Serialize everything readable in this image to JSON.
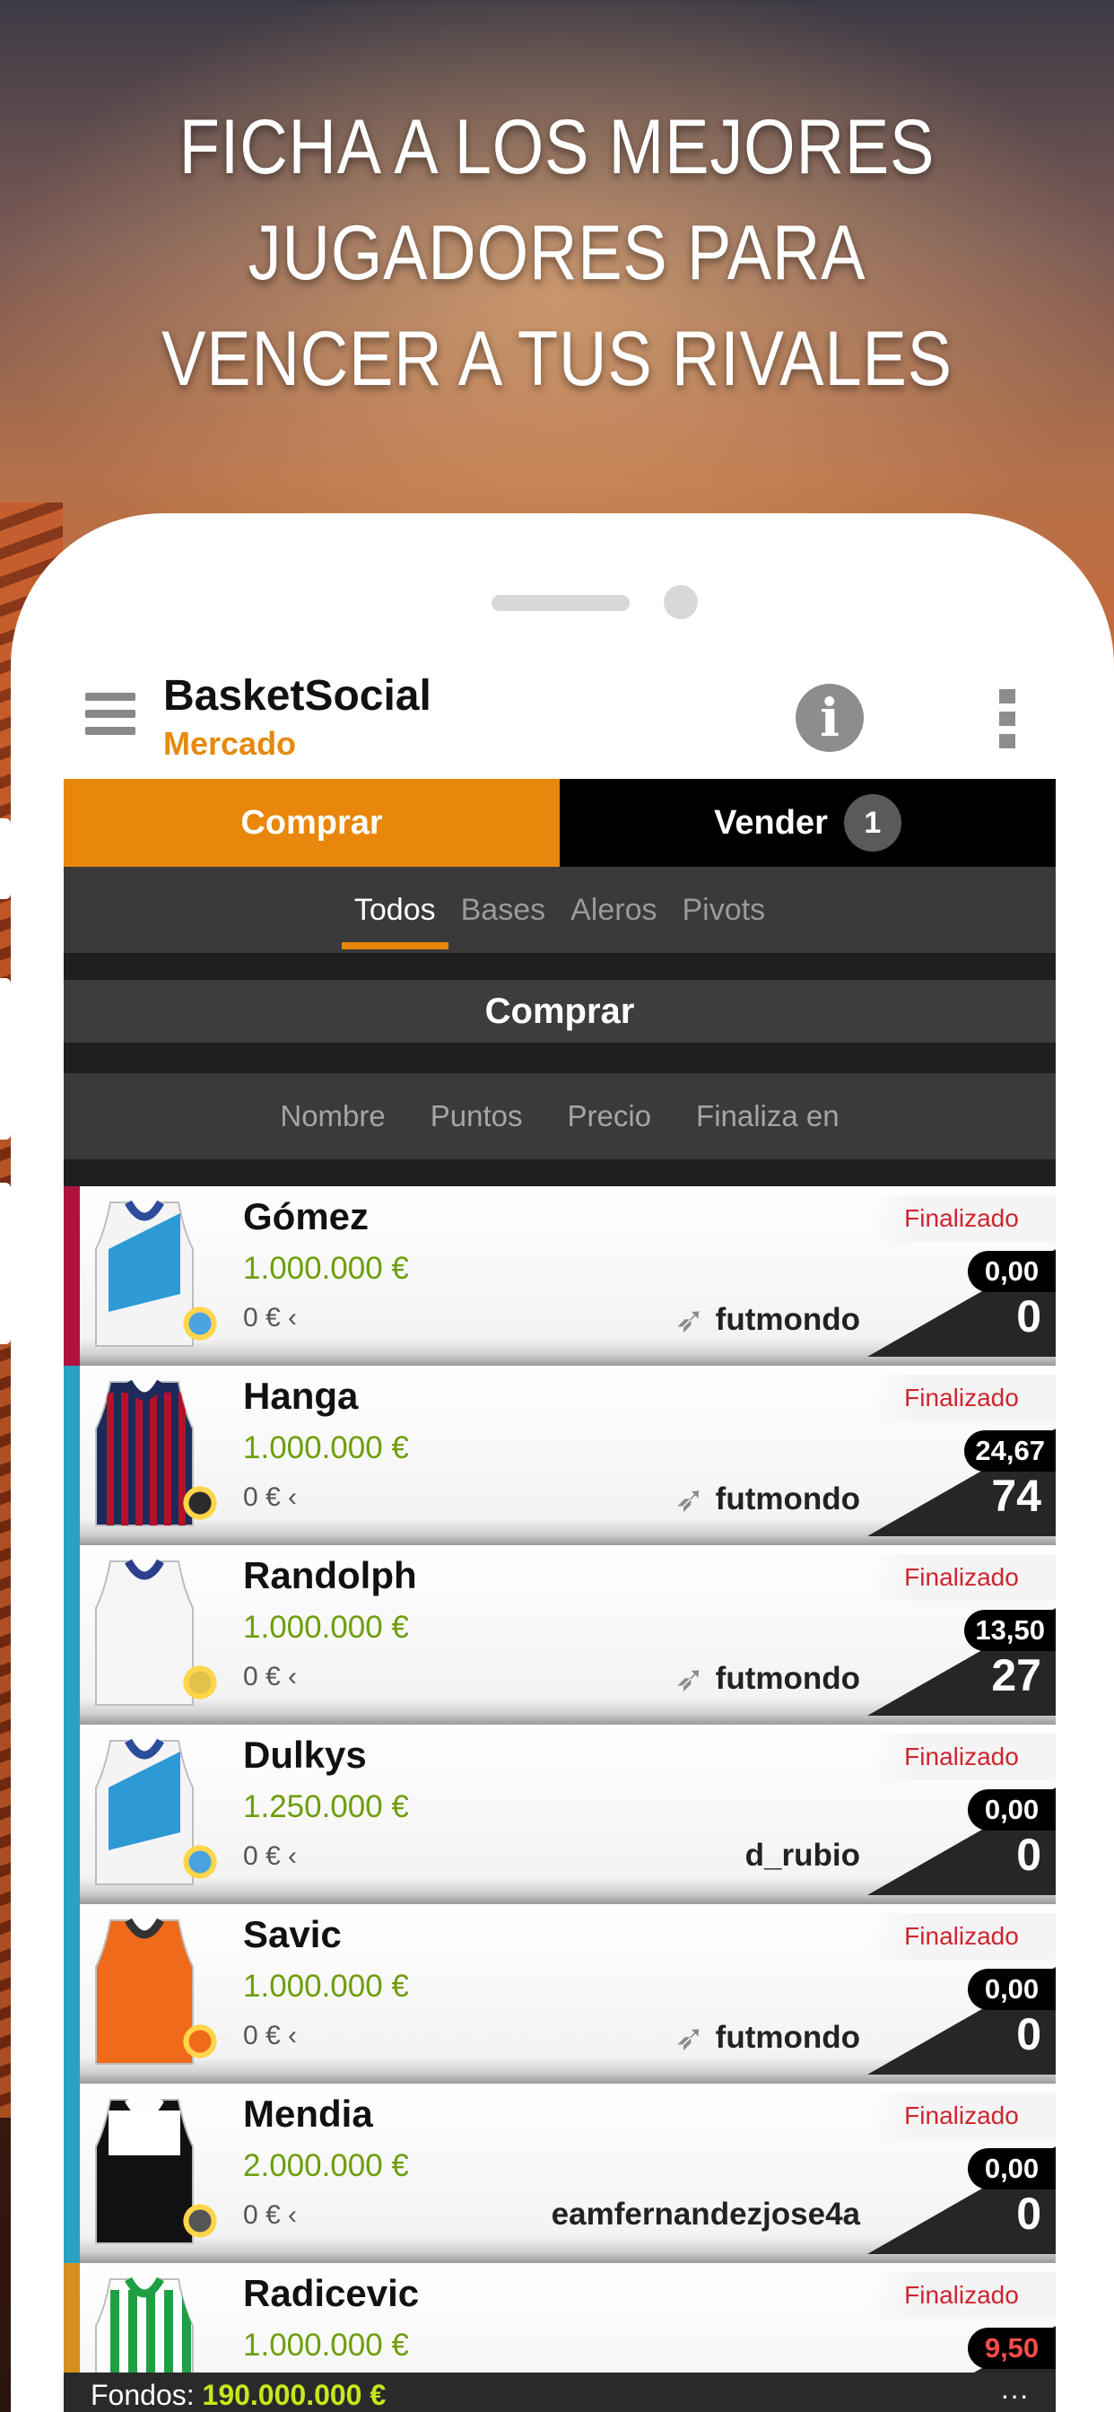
{
  "headline": [
    "FICHA A LOS MEJORES",
    "JUGADORES PARA",
    "VENCER A TUS RIVALES"
  ],
  "app": {
    "title": "BasketSocial",
    "subtitle": "Mercado"
  },
  "main_tabs": {
    "buy": "Comprar",
    "sell": "Vender",
    "sell_badge": "1"
  },
  "filters": [
    "Todos",
    "Bases",
    "Aleros",
    "Pivots"
  ],
  "section_title": "Comprar",
  "sort_options": [
    "Nombre",
    "Puntos",
    "Precio",
    "Finaliza en"
  ],
  "players": [
    {
      "name": "Gómez",
      "price": "1.000.000 €",
      "clause": "0 €",
      "owner": "futmondo",
      "owner_icon": "rocket-icon",
      "status": "Finalizado",
      "avg": "0,00",
      "points": "0",
      "stripe": "#b0123e",
      "jersey": "blue-white"
    },
    {
      "name": "Hanga",
      "price": "1.000.000 €",
      "clause": "0 €",
      "owner": "futmondo",
      "owner_icon": "rocket-icon",
      "status": "Finalizado",
      "avg": "24,67",
      "points": "74",
      "stripe": "#2aa0c2",
      "jersey": "red-navy"
    },
    {
      "name": "Randolph",
      "price": "1.000.000 €",
      "clause": "0 €",
      "owner": "futmondo",
      "owner_icon": "rocket-icon",
      "status": "Finalizado",
      "avg": "13,50",
      "points": "27",
      "stripe": "#2aa0c2",
      "jersey": "white-navy"
    },
    {
      "name": "Dulkys",
      "price": "1.250.000 €",
      "clause": "0 €",
      "owner": "d_rubio",
      "owner_icon": "",
      "status": "Finalizado",
      "avg": "0,00",
      "points": "0",
      "stripe": "#2aa0c2",
      "jersey": "blue-white"
    },
    {
      "name": "Savic",
      "price": "1.000.000 €",
      "clause": "0 €",
      "owner": "futmondo",
      "owner_icon": "rocket-icon",
      "status": "Finalizado",
      "avg": "0,00",
      "points": "0",
      "stripe": "#2aa0c2",
      "jersey": "orange"
    },
    {
      "name": "Mendia",
      "price": "2.000.000 €",
      "clause": "0 €",
      "owner": "eamfernandezjose4a",
      "owner_icon": "",
      "status": "Finalizado",
      "avg": "0,00",
      "points": "0",
      "stripe": "#2aa0c2",
      "jersey": "black-white"
    },
    {
      "name": "Radicevic",
      "price": "1.000.000 €",
      "clause": "",
      "owner": "",
      "owner_icon": "",
      "status": "Finalizado",
      "avg": "9,50",
      "points": "",
      "stripe": "#d4901c",
      "jersey": "green-white"
    }
  ],
  "footer": {
    "label": "Fondos:",
    "value": "190.000.000 €"
  }
}
